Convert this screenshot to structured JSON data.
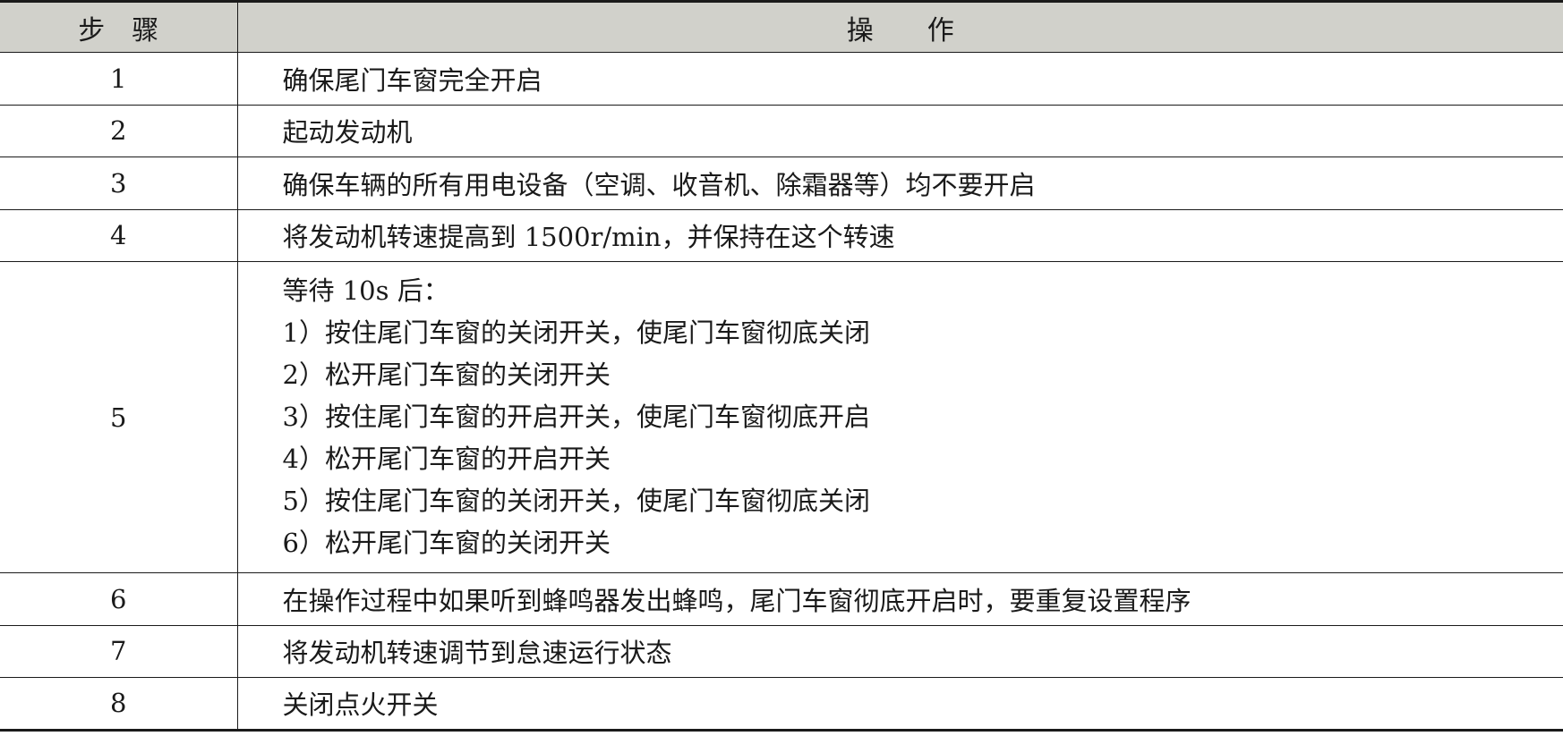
{
  "table": {
    "header": {
      "step": "步　骤",
      "operation": "操　　作"
    },
    "rows": [
      {
        "step": "1",
        "operation": "确保尾门车窗完全开启"
      },
      {
        "step": "2",
        "operation": "起动发动机"
      },
      {
        "step": "3",
        "operation": "确保车辆的所有用电设备（空调、收音机、除霜器等）均不要开启"
      },
      {
        "step": "4",
        "operation": "将发动机转速提高到 1500r/min，并保持在这个转速"
      },
      {
        "step": "5",
        "lines": [
          "等待 10s 后：",
          "1）按住尾门车窗的关闭开关，使尾门车窗彻底关闭",
          "2）松开尾门车窗的关闭开关",
          "3）按住尾门车窗的开启开关，使尾门车窗彻底开启",
          "4）松开尾门车窗的开启开关",
          "5）按住尾门车窗的关闭开关，使尾门车窗彻底关闭",
          "6）松开尾门车窗的关闭开关"
        ]
      },
      {
        "step": "6",
        "operation": "在操作过程中如果听到蜂鸣器发出蜂鸣，尾门车窗彻底开启时，要重复设置程序"
      },
      {
        "step": "7",
        "operation": "将发动机转速调节到怠速运行状态"
      },
      {
        "step": "8",
        "operation": "关闭点火开关"
      }
    ]
  }
}
